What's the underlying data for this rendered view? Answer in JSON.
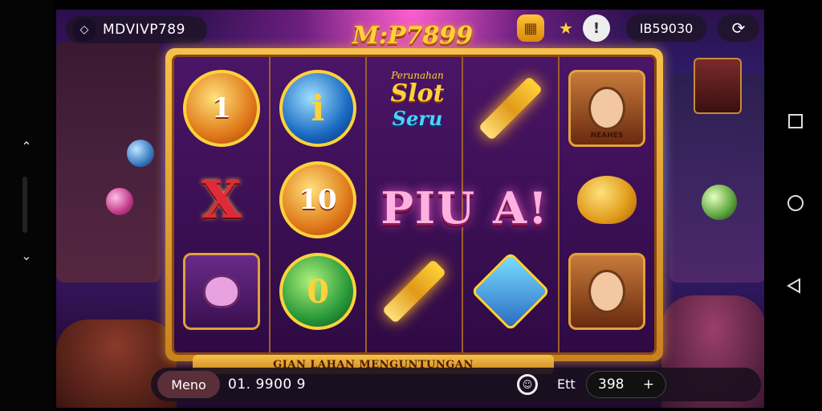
{
  "hud": {
    "brand_label": "MDVIVP789",
    "logo_text": "M:P7899",
    "balance": "IB59030"
  },
  "reels": {
    "title_sub": "Perunahan",
    "title_word": "Slot",
    "title_word2": "Seru",
    "big_text": "PIU A!",
    "coin_value": "1",
    "ten_value": "10",
    "green_value": "0",
    "blue_value": "i",
    "x_symbol": "X",
    "portrait_label": "NEAHES"
  },
  "banner": {
    "text": "GIAN LAHAN MENGUNTUNGAN"
  },
  "bottom": {
    "menu_label": "Meno",
    "bet_readout": "01. 9900 9",
    "bet_label": "Ett",
    "stake_value": "398",
    "plus": "+"
  },
  "icons": {
    "brand": "diamond-icon",
    "grid": "grid-icon",
    "trophy": "trophy-icon",
    "alert": "alert-icon",
    "refresh": "refresh-icon",
    "spin": "smiley-icon"
  },
  "colors": {
    "gold": "#f7c24a",
    "purple_bg": "#3a145c",
    "pink_glow": "#ff5fd2"
  }
}
